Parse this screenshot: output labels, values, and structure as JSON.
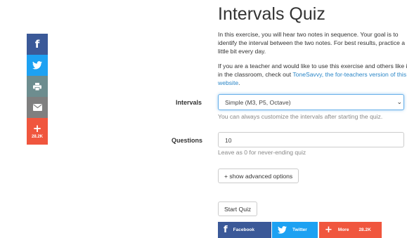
{
  "share_sidebar": {
    "more_count": "28.2K",
    "icons": [
      "facebook-icon",
      "twitter-icon",
      "print-icon",
      "email-icon",
      "plus-icon"
    ]
  },
  "quiz": {
    "title": "Intervals Quiz",
    "intro_1": "In this exercise, you will hear two notes in sequence. Your goal is to identify the interval between the two notes. For best results, practice a little bit every day.",
    "intro_2_prefix": "If you are a teacher and would like to use this exercise and others like it in the classroom, check out ",
    "intro_2_link": "ToneSavvy, the for-teachers version of this website",
    "intro_2_suffix": "."
  },
  "form": {
    "intervals_label": "Intervals",
    "intervals_value": "Simple (M3, P5, Octave)",
    "intervals_help": "You can always customize the intervals after starting the quiz.",
    "questions_label": "Questions",
    "questions_value": "10",
    "questions_help": "Leave as 0 for never-ending quiz",
    "advanced_button": "+ show advanced options",
    "start_button": "Start Quiz"
  },
  "bottom_share": {
    "facebook_label": "Facebook",
    "twitter_label": "Twitter",
    "more_label": "More",
    "more_count": "28.2K"
  },
  "colors": {
    "facebook": "#3b5998",
    "twitter": "#1da1f2",
    "print": "#6d8d8f",
    "email": "#7f7f7f",
    "more": "#f0563e",
    "link": "#2a86c7"
  }
}
